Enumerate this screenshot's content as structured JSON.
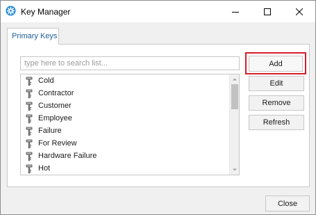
{
  "window": {
    "title": "Key Manager",
    "app_icon": "gear-settings-icon",
    "accent_color": "#1c5e9e",
    "highlight_color": "#d51d2a"
  },
  "tabs": [
    {
      "label": "Primary Keys",
      "selected": true
    }
  ],
  "search": {
    "placeholder": "type here to search list...",
    "value": ""
  },
  "list": {
    "item_icon": "key-icon",
    "items": [
      {
        "label": "Cold"
      },
      {
        "label": "Contractor"
      },
      {
        "label": "Customer"
      },
      {
        "label": "Employee"
      },
      {
        "label": "Failure"
      },
      {
        "label": "For Review"
      },
      {
        "label": "Hardware Failure"
      },
      {
        "label": "Hot"
      }
    ]
  },
  "actions": {
    "add_label": "Add",
    "edit_label": "Edit",
    "remove_label": "Remove",
    "refresh_label": "Refresh"
  },
  "footer": {
    "close_label": "Close"
  }
}
